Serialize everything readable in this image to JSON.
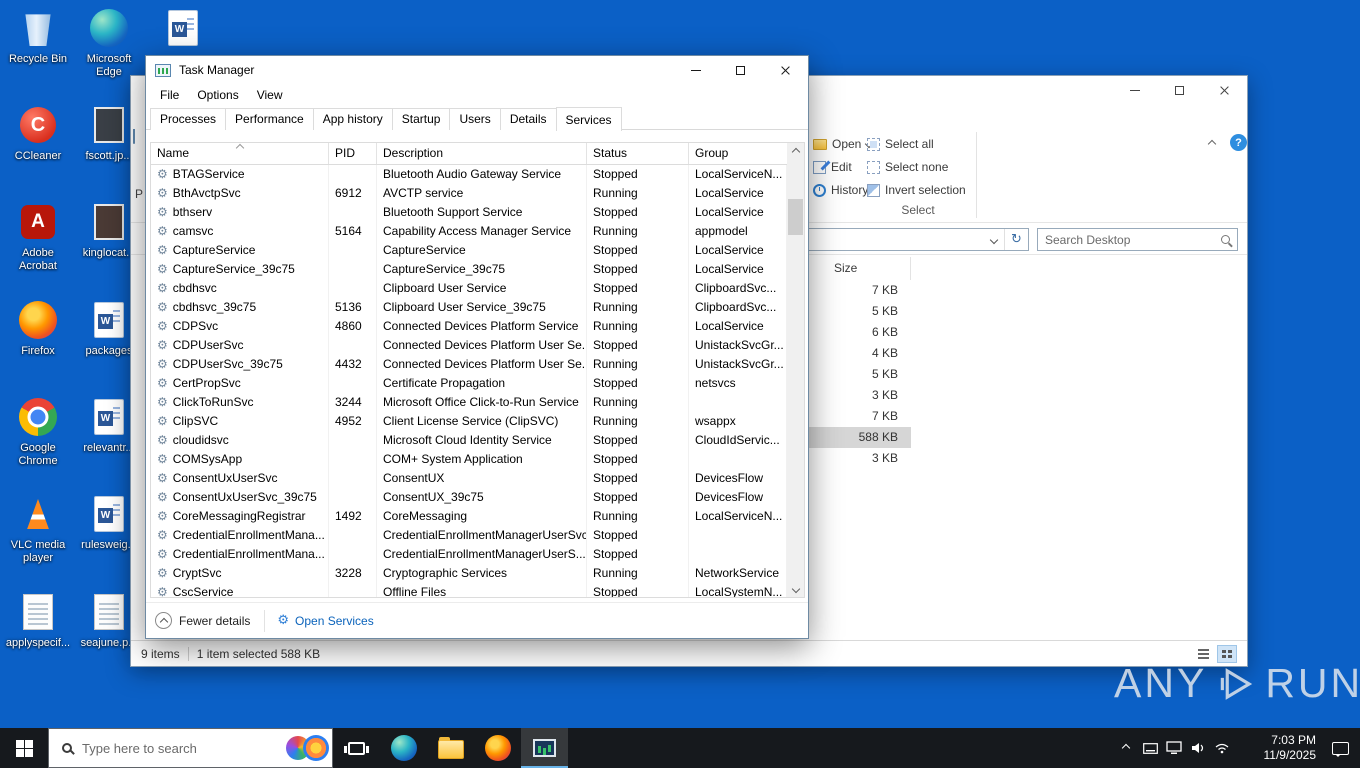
{
  "desktop": {
    "icons": [
      {
        "label": "Recycle Bin",
        "icon": "recycle-bin"
      },
      {
        "label": "Microsoft Edge",
        "icon": "edge"
      },
      {
        "label": "CCleaner",
        "icon": "ccleaner"
      },
      {
        "label": "fscott.jp...",
        "icon": "image-file"
      },
      {
        "label": "Adobe Acrobat",
        "icon": "acrobat"
      },
      {
        "label": "kinglocat...",
        "icon": "dark-file"
      },
      {
        "label": "Firefox",
        "icon": "firefox"
      },
      {
        "label": "packages",
        "icon": "word-doc"
      },
      {
        "label": "Google Chrome",
        "icon": "chrome"
      },
      {
        "label": "relevantr...",
        "icon": "word-doc"
      },
      {
        "label": "VLC media player",
        "icon": "vlc"
      },
      {
        "label": "rulesweig...",
        "icon": "word-doc"
      },
      {
        "label": "applyspecif...",
        "icon": "text-file"
      },
      {
        "label": "seajune.p...",
        "icon": "text-file"
      },
      {
        "label": "",
        "icon": "word-doc"
      }
    ]
  },
  "task_manager": {
    "title": "Task Manager",
    "menu": [
      "File",
      "Options",
      "View"
    ],
    "tabs": [
      "Processes",
      "Performance",
      "App history",
      "Startup",
      "Users",
      "Details",
      "Services"
    ],
    "active_tab": "Services",
    "columns": [
      "Name",
      "PID",
      "Description",
      "Status",
      "Group"
    ],
    "services": [
      {
        "name": "BTAGService",
        "pid": "",
        "description": "Bluetooth Audio Gateway Service",
        "status": "Stopped",
        "group": "LocalServiceN..."
      },
      {
        "name": "BthAvctpSvc",
        "pid": "6912",
        "description": "AVCTP service",
        "status": "Running",
        "group": "LocalService"
      },
      {
        "name": "bthserv",
        "pid": "",
        "description": "Bluetooth Support Service",
        "status": "Stopped",
        "group": "LocalService"
      },
      {
        "name": "camsvc",
        "pid": "5164",
        "description": "Capability Access Manager Service",
        "status": "Running",
        "group": "appmodel"
      },
      {
        "name": "CaptureService",
        "pid": "",
        "description": "CaptureService",
        "status": "Stopped",
        "group": "LocalService"
      },
      {
        "name": "CaptureService_39c75",
        "pid": "",
        "description": "CaptureService_39c75",
        "status": "Stopped",
        "group": "LocalService"
      },
      {
        "name": "cbdhsvc",
        "pid": "",
        "description": "Clipboard User Service",
        "status": "Stopped",
        "group": "ClipboardSvc..."
      },
      {
        "name": "cbdhsvc_39c75",
        "pid": "5136",
        "description": "Clipboard User Service_39c75",
        "status": "Running",
        "group": "ClipboardSvc..."
      },
      {
        "name": "CDPSvc",
        "pid": "4860",
        "description": "Connected Devices Platform Service",
        "status": "Running",
        "group": "LocalService"
      },
      {
        "name": "CDPUserSvc",
        "pid": "",
        "description": "Connected Devices Platform User Se...",
        "status": "Stopped",
        "group": "UnistackSvcGr..."
      },
      {
        "name": "CDPUserSvc_39c75",
        "pid": "4432",
        "description": "Connected Devices Platform User Se...",
        "status": "Running",
        "group": "UnistackSvcGr..."
      },
      {
        "name": "CertPropSvc",
        "pid": "",
        "description": "Certificate Propagation",
        "status": "Stopped",
        "group": "netsvcs"
      },
      {
        "name": "ClickToRunSvc",
        "pid": "3244",
        "description": "Microsoft Office Click-to-Run Service",
        "status": "Running",
        "group": ""
      },
      {
        "name": "ClipSVC",
        "pid": "4952",
        "description": "Client License Service (ClipSVC)",
        "status": "Running",
        "group": "wsappx"
      },
      {
        "name": "cloudidsvc",
        "pid": "",
        "description": "Microsoft Cloud Identity Service",
        "status": "Stopped",
        "group": "CloudIdServic..."
      },
      {
        "name": "COMSysApp",
        "pid": "",
        "description": "COM+ System Application",
        "status": "Stopped",
        "group": ""
      },
      {
        "name": "ConsentUxUserSvc",
        "pid": "",
        "description": "ConsentUX",
        "status": "Stopped",
        "group": "DevicesFlow"
      },
      {
        "name": "ConsentUxUserSvc_39c75",
        "pid": "",
        "description": "ConsentUX_39c75",
        "status": "Stopped",
        "group": "DevicesFlow"
      },
      {
        "name": "CoreMessagingRegistrar",
        "pid": "1492",
        "description": "CoreMessaging",
        "status": "Running",
        "group": "LocalServiceN..."
      },
      {
        "name": "CredentialEnrollmentMana...",
        "pid": "",
        "description": "CredentialEnrollmentManagerUserSvc",
        "status": "Stopped",
        "group": ""
      },
      {
        "name": "CredentialEnrollmentMana...",
        "pid": "",
        "description": "CredentialEnrollmentManagerUserS...",
        "status": "Stopped",
        "group": ""
      },
      {
        "name": "CryptSvc",
        "pid": "3228",
        "description": "Cryptographic Services",
        "status": "Running",
        "group": "NetworkService"
      },
      {
        "name": "CscService",
        "pid": "",
        "description": "Offline Files",
        "status": "Stopped",
        "group": "LocalSystemN..."
      }
    ],
    "footer": {
      "fewer_details": "Fewer details",
      "open_services": "Open Services"
    }
  },
  "explorer": {
    "ribbon": {
      "paste_fragment": "P",
      "open": "Open",
      "edit": "Edit",
      "history": "History",
      "select_all": "Select all",
      "select_none": "Select none",
      "invert_selection": "Invert selection",
      "group_label": "Select",
      "help_label": "?"
    },
    "search_placeholder": "Search Desktop",
    "size_column": "Size",
    "files": [
      {
        "size": "7 KB"
      },
      {
        "size": "5 KB"
      },
      {
        "size": "6 KB"
      },
      {
        "size": "4 KB"
      },
      {
        "size": "5 KB"
      },
      {
        "size": "3 KB"
      },
      {
        "size": "7 KB"
      },
      {
        "size": "588 KB",
        "selected": true
      },
      {
        "size": "3 KB"
      }
    ],
    "status": {
      "items": "9 items",
      "selection": "1 item selected 588 KB"
    }
  },
  "taskbar": {
    "search_placeholder": "Type here to search",
    "time": "7:03 PM",
    "date": "11/9/2025"
  },
  "watermark": {
    "left": "ANY",
    "right": "RUN"
  }
}
